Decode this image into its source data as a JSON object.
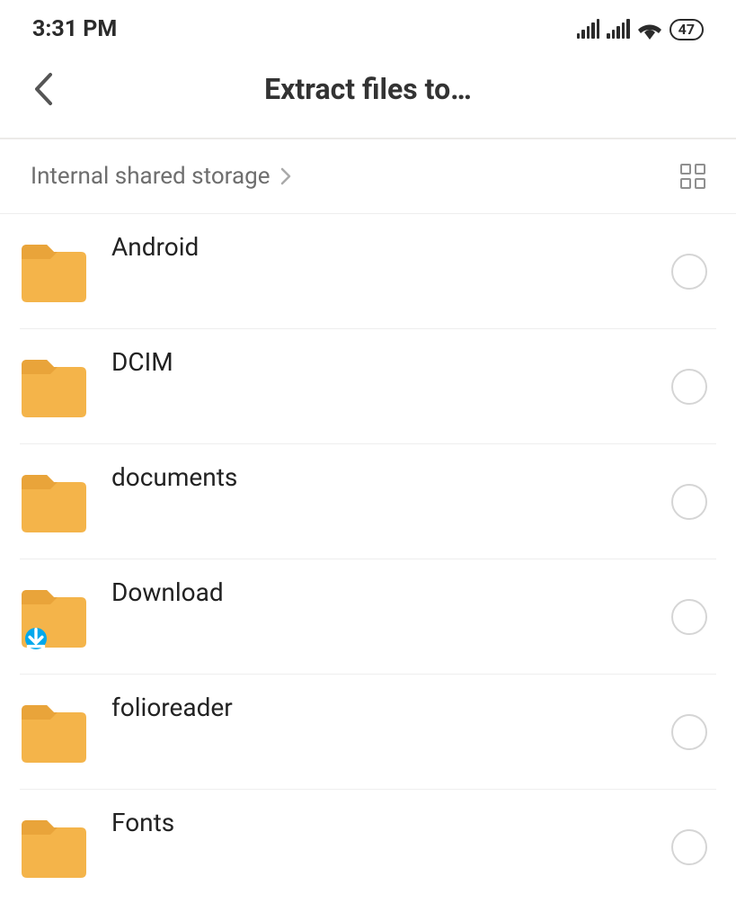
{
  "status": {
    "time": "3:31 PM",
    "battery": "47"
  },
  "header": {
    "title": "Extract files to…"
  },
  "breadcrumb": {
    "path": "Internal shared storage"
  },
  "folders": [
    {
      "name": "Android",
      "badge": null
    },
    {
      "name": "DCIM",
      "badge": null
    },
    {
      "name": "documents",
      "badge": null
    },
    {
      "name": "Download",
      "badge": "download"
    },
    {
      "name": "folioreader",
      "badge": null
    },
    {
      "name": "Fonts",
      "badge": null
    }
  ]
}
